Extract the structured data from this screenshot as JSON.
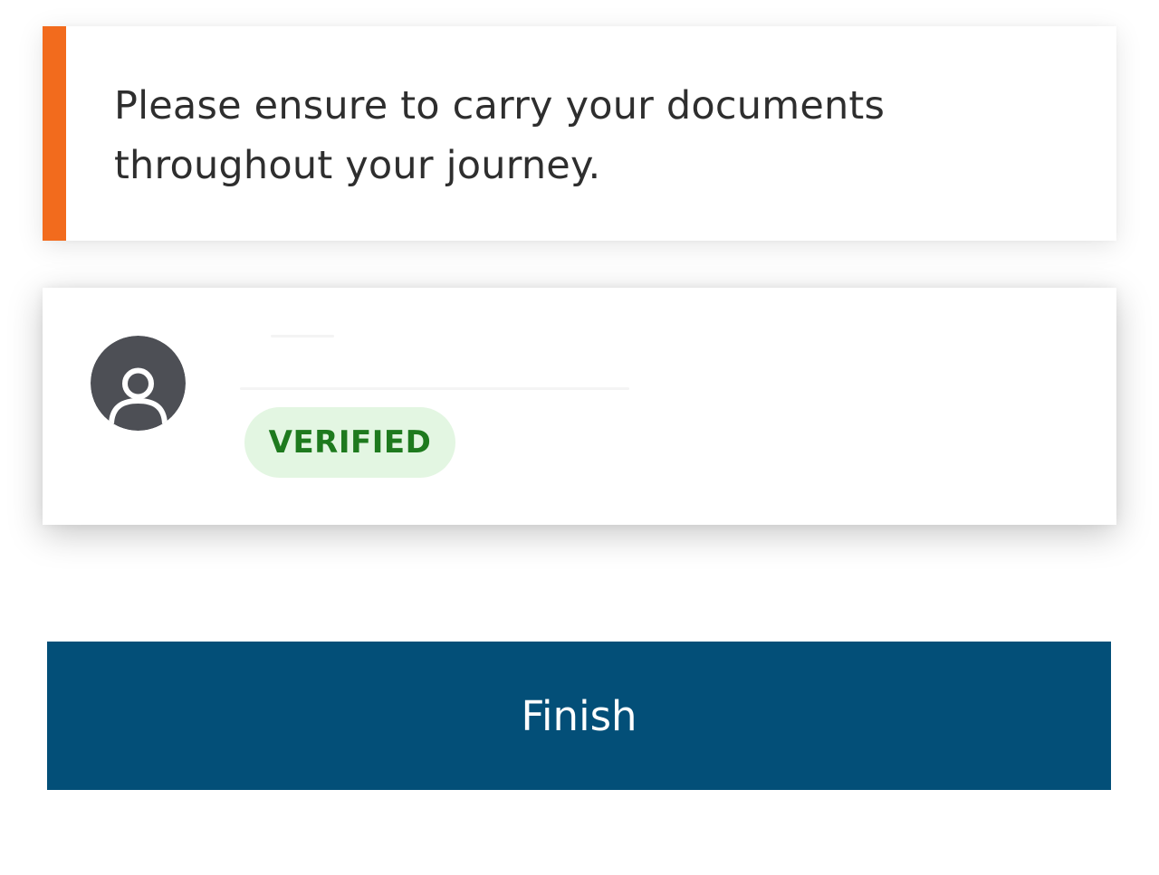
{
  "notice": {
    "message": "Please ensure to carry your documents throughout your journey.",
    "accent_color": "#f26b1d"
  },
  "traveller": {
    "avatar_icon": "user-icon",
    "avatar_color": "#4d4f55",
    "status": {
      "label": "VERIFIED",
      "text_color": "#1e7a1e",
      "background_color": "#e3f6e2"
    }
  },
  "actions": {
    "finish_label": "Finish",
    "finish_color": "#034f78"
  }
}
